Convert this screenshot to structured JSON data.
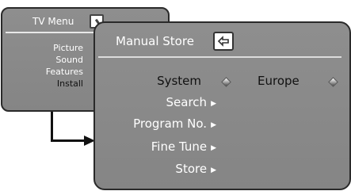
{
  "tv_menu": {
    "title": "TV Menu",
    "items": [
      {
        "label": "Picture"
      },
      {
        "label": "Sound"
      },
      {
        "label": "Features"
      },
      {
        "label": "Install"
      }
    ]
  },
  "manual_store": {
    "title": "Manual Store",
    "items": [
      {
        "label": "System",
        "value": "Europe"
      },
      {
        "label": "Search"
      },
      {
        "label": "Program No."
      },
      {
        "label": "Fine Tune"
      },
      {
        "label": "Store"
      }
    ]
  }
}
